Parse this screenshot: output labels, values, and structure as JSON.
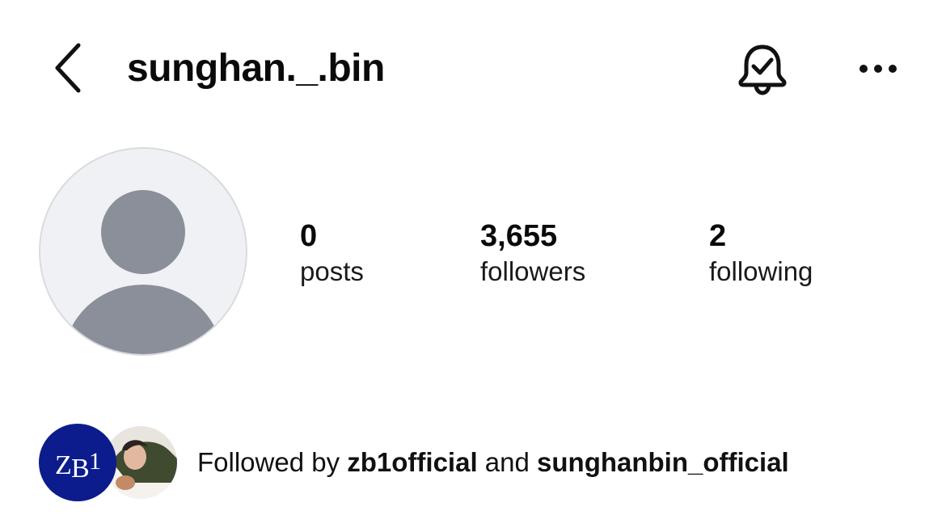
{
  "header": {
    "username": "sunghan._.bin",
    "back_icon": "chevron-left-icon",
    "bell_icon": "bell-check-icon",
    "more_icon": "more-horizontal-icon"
  },
  "profile": {
    "avatar_icon": "default-avatar-icon"
  },
  "stats": {
    "posts": {
      "value": "0",
      "label": "posts"
    },
    "followers": {
      "value": "3,655",
      "label": "followers"
    },
    "following": {
      "value": "2",
      "label": "following"
    }
  },
  "followed_by": {
    "prefix": "Followed by",
    "user1": "zb1official",
    "conjunction": "and",
    "user2": "sunghanbin_official",
    "avatar1_logo_text": "ZB1",
    "avatar1_color": "#0c1c8c"
  },
  "colors": {
    "avatar_bg": "#eff0f3",
    "avatar_figure": "#8a8f99"
  }
}
